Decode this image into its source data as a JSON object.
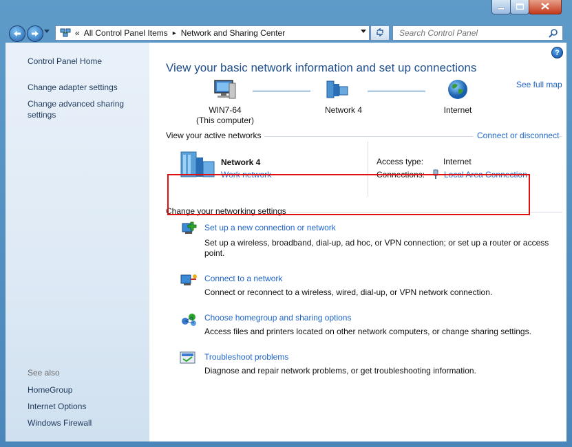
{
  "window": {
    "title_buttons": {
      "minimize": "minimize-icon",
      "maximize": "maximize-icon",
      "close": "close-icon"
    }
  },
  "address_bar": {
    "overflow": "«",
    "breadcrumbs": [
      "All Control Panel Items",
      "Network and Sharing Center"
    ],
    "separator": "▸",
    "search_placeholder": "Search Control Panel"
  },
  "sidebar": {
    "items": [
      "Control Panel Home",
      "Change adapter settings",
      "Change advanced sharing settings"
    ],
    "see_also_label": "See also",
    "see_also": [
      "HomeGroup",
      "Internet Options",
      "Windows Firewall"
    ]
  },
  "main": {
    "title": "View your basic network information and set up connections",
    "see_full_map": "See full map",
    "map": {
      "computer_name": "WIN7-64",
      "computer_sub": "(This computer)",
      "network_name": "Network  4",
      "internet": "Internet"
    },
    "active_networks": {
      "heading": "View your active networks",
      "connect_link": "Connect or disconnect",
      "network_name": "Network  4",
      "network_type": "Work network",
      "access_type_label": "Access type:",
      "access_type_value": "Internet",
      "connections_label": "Connections:",
      "connections_value": "Local Area Connection"
    },
    "settings": {
      "heading": "Change your networking settings",
      "tasks": [
        {
          "title": "Set up a new connection or network",
          "desc": "Set up a wireless, broadband, dial-up, ad hoc, or VPN connection; or set up a router or access point."
        },
        {
          "title": "Connect to a network",
          "desc": "Connect or reconnect to a wireless, wired, dial-up, or VPN network connection."
        },
        {
          "title": "Choose homegroup and sharing options",
          "desc": "Access files and printers located on other network computers, or change sharing settings."
        },
        {
          "title": "Troubleshoot problems",
          "desc": "Diagnose and repair network problems, or get troubleshooting information."
        }
      ]
    }
  },
  "colors": {
    "highlight": "#e01010",
    "link": "#1e64c8",
    "title": "#1e4e8c"
  }
}
